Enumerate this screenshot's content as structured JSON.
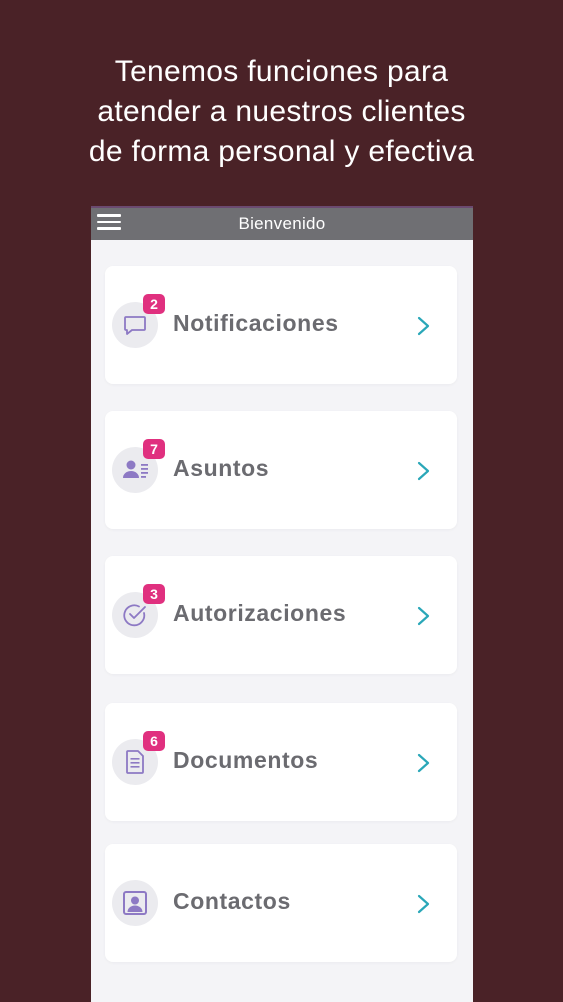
{
  "headline": {
    "line1": "Tenemos funciones para",
    "line2": "atender a nuestros clientes",
    "line3": "de forma personal y efectiva"
  },
  "appbar": {
    "title": "Bienvenido",
    "menu_icon": "hamburger-menu-icon"
  },
  "colors": {
    "background": "#4a2227",
    "badge": "#e0307f",
    "chevron": "#2aa7b8",
    "icon": "#8d79c4"
  },
  "cards": [
    {
      "label": "Notificaciones",
      "badge": "2",
      "icon": "chat-bubble-icon"
    },
    {
      "label": "Asuntos",
      "badge": "7",
      "icon": "contact-card-icon"
    },
    {
      "label": "Autorizaciones",
      "badge": "3",
      "icon": "check-circle-icon"
    },
    {
      "label": "Documentos",
      "badge": "6",
      "icon": "document-icon"
    },
    {
      "label": "Contactos",
      "badge": "",
      "icon": "user-portrait-icon"
    }
  ]
}
